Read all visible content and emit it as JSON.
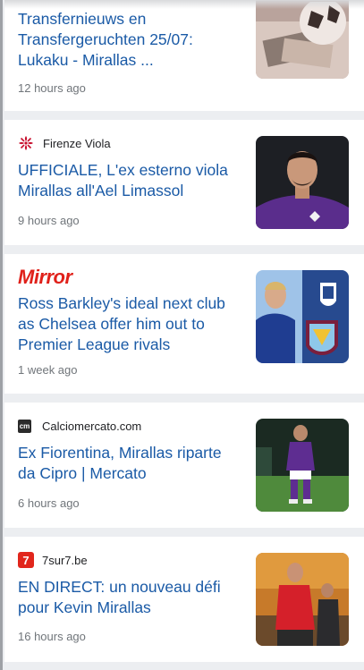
{
  "feed": {
    "articles": [
      {
        "source": "",
        "title": "Transfernieuws en Transfergeruchten 25/07: Lukaku - Mirallas ...",
        "time": "12 hours ago",
        "thumbnail": "money-and-ball-photo"
      },
      {
        "source": "Firenze Viola",
        "logo_icon": "fiorentina-lily-icon",
        "title": "UFFICIALE, L'ex esterno viola Mirallas all'Ael Limassol",
        "time": "9 hours ago",
        "thumbnail": "player-in-purple-kit-photo"
      },
      {
        "source": "Mirror",
        "logo_icon": "mirror-wordmark",
        "title": "Ross Barkley's ideal next club as Chelsea offer him out to Premier League rivals",
        "time": "1 week ago",
        "thumbnail": "club-crests-composite-photo"
      },
      {
        "source": "Calciomercato.com",
        "logo_icon": "cm-logo-icon",
        "title": "Ex Fiorentina, Mirallas riparte da Cipro | Mercato",
        "time": "6 hours ago",
        "thumbnail": "player-on-pitch-photo"
      },
      {
        "source": "7sur7.be",
        "logo_icon": "7sur7-logo-icon",
        "title": "EN DIRECT: un nouveau défi pour Kevin Mirallas",
        "time": "16 hours ago",
        "thumbnail": "player-in-red-jacket-photo"
      }
    ]
  },
  "logos": {
    "mirror_text": "Mirror",
    "cm_text": "cm",
    "sur_text": "7"
  },
  "colors": {
    "title_link": "#1a5aa6",
    "meta_text": "#70757a",
    "mirror_red": "#e0211a",
    "sur7_red": "#e1261c",
    "fiorentina_red": "#c8102e"
  }
}
